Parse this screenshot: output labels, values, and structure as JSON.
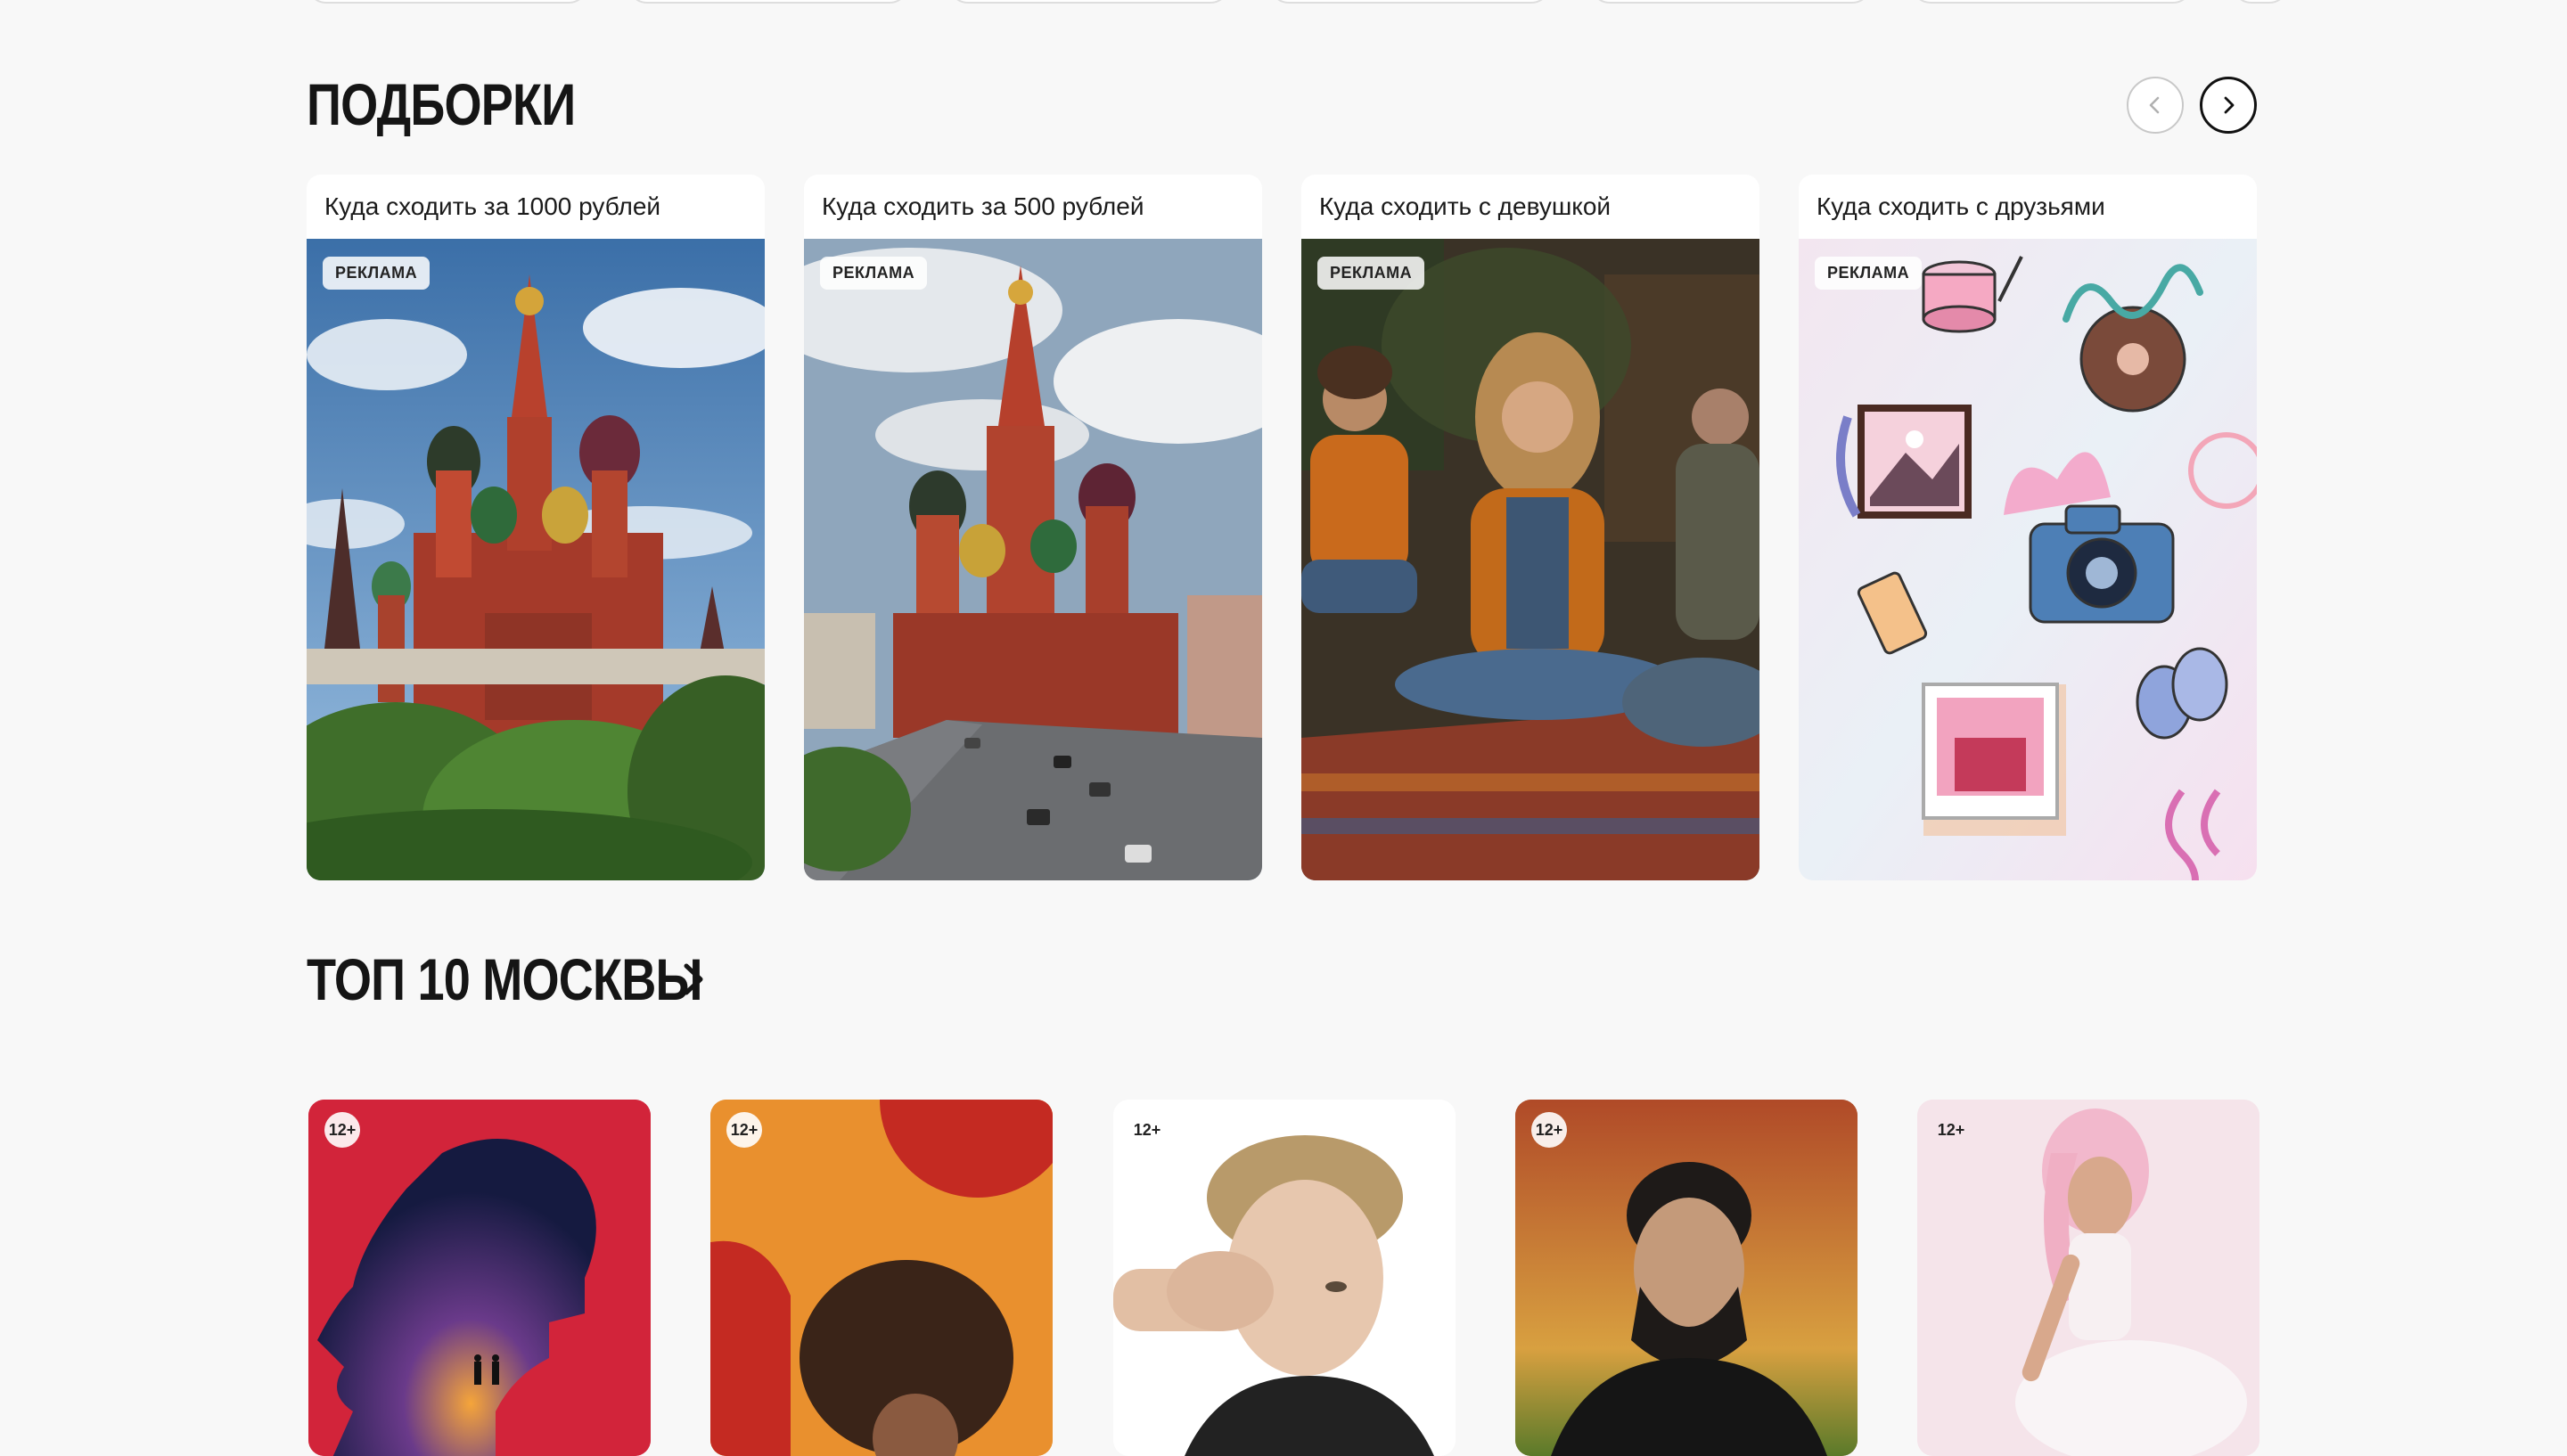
{
  "collections": {
    "title": "ПОДБОРКИ",
    "items": [
      {
        "title": "Куда сходить за 1000 рублей",
        "badge": "РЕКЛАМА"
      },
      {
        "title": "Куда сходить за 500 рублей",
        "badge": "РЕКЛАМА"
      },
      {
        "title": "Куда сходить с девушкой",
        "badge": "РЕКЛАМА"
      },
      {
        "title": "Куда сходить с друзьями",
        "badge": "РЕКЛАМА"
      }
    ]
  },
  "top": {
    "title": "ТОП 10 МОСКВЫ",
    "cards": [
      {
        "age": "12+"
      },
      {
        "age": "12+"
      },
      {
        "age": "12+"
      },
      {
        "age": "12+"
      },
      {
        "age": "12+"
      }
    ]
  },
  "icons": {
    "prev": "chevron-left-icon",
    "next": "chevron-right-icon",
    "top_link": "chevron-right-icon"
  },
  "colors": {
    "background": "#f8f8f8",
    "text": "#151515",
    "card": "#ffffff"
  }
}
